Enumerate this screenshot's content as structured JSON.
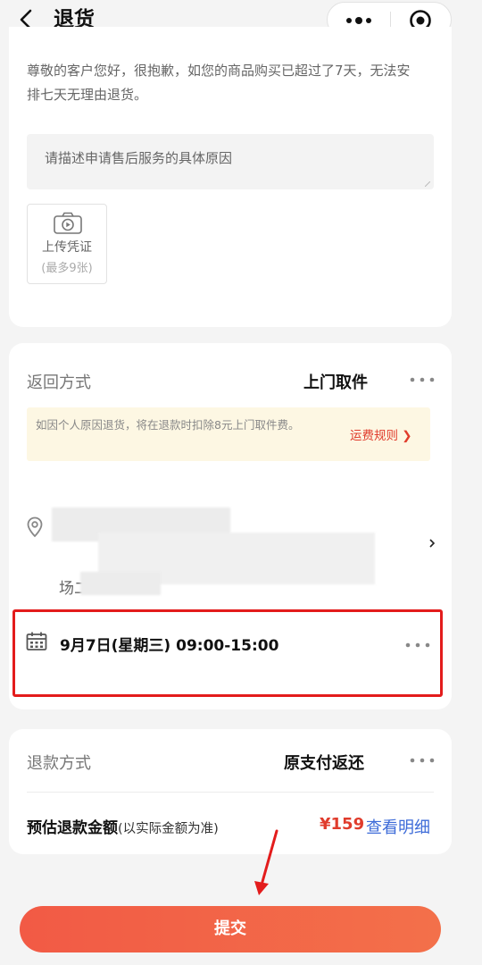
{
  "header": {
    "title": "退货"
  },
  "apply": {
    "notice": "尊敬的客户您好，很抱歉，如您的商品购买已超过了7天，无法安排七天无理由退货。",
    "reason_placeholder": "请描述申请售后服务的具体原因",
    "upload_label": "上传凭证",
    "upload_sub": "(最多9张)"
  },
  "return": {
    "label": "返回方式",
    "value": "上门取件",
    "fee_notice": "如因个人原因退货，将在退款时扣除8元上门取件费。",
    "fee_link": "运费规则 ❯",
    "address_tail": "场二",
    "pickup_time": "9月7日(星期三) 09:00-15:00"
  },
  "refund": {
    "label": "退款方式",
    "value": "原支付返还",
    "estimate_label": "预估退款金额",
    "estimate_note": "(以实际金额为准)",
    "amount": "¥159",
    "detail_link": "查看明细"
  },
  "submit_label": "提交",
  "colors": {
    "accent": "#f25a45",
    "price": "#e03c2c",
    "link": "#3d6bd8",
    "highlight": "#e31c1c"
  }
}
